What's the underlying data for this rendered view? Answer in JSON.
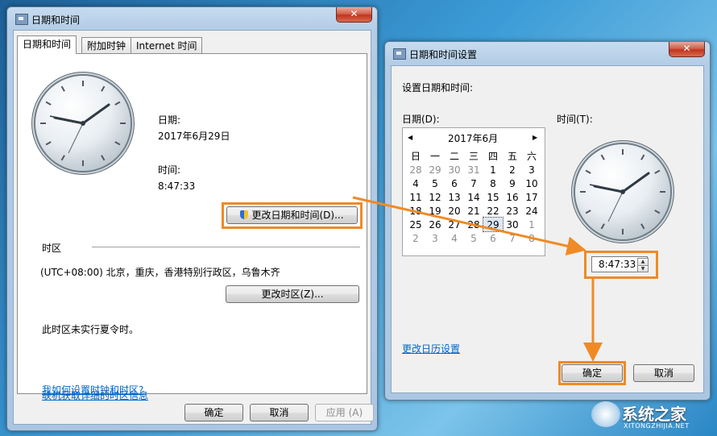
{
  "left_window": {
    "title": "日期和时间",
    "close": "✕",
    "tabs": [
      "日期和时间",
      "附加时钟",
      "Internet 时间"
    ],
    "date_label": "日期:",
    "date_value": "2017年6月29日",
    "time_label": "时间:",
    "time_value": "8:47:33",
    "change_datetime_button": "更改日期和时间(D)...",
    "timezone_heading": "时区",
    "timezone_value": "(UTC+08:00) 北京，重庆，香港特别行政区，乌鲁木齐",
    "change_timezone_button": "更改时区(Z)...",
    "dst_note": "此时区未实行夏令时。",
    "links": [
      "联机获取详细的时区信息",
      "我如何设置时钟和时区?"
    ],
    "ok": "确定",
    "cancel": "取消",
    "apply": "应用 (A)"
  },
  "right_window": {
    "title": "日期和时间设置",
    "close": "✕",
    "prompt": "设置日期和时间:",
    "date_label": "日期(D):",
    "time_label": "时间(T):",
    "month": "2017年6月",
    "prev": "◀",
    "next": "▶",
    "weekdays": [
      "日",
      "一",
      "二",
      "三",
      "四",
      "五",
      "六"
    ],
    "weeks": [
      [
        "28",
        "29",
        "30",
        "31",
        "1",
        "2",
        "3"
      ],
      [
        "4",
        "5",
        "6",
        "7",
        "8",
        "9",
        "10"
      ],
      [
        "11",
        "12",
        "13",
        "14",
        "15",
        "16",
        "17"
      ],
      [
        "18",
        "19",
        "20",
        "21",
        "22",
        "23",
        "24"
      ],
      [
        "25",
        "26",
        "27",
        "28",
        "29",
        "30",
        "1"
      ],
      [
        "2",
        "3",
        "4",
        "5",
        "6",
        "7",
        "8"
      ]
    ],
    "selected_day": "29",
    "time_value": "8:47:33",
    "calendar_link": "更改日历设置",
    "ok": "确定",
    "cancel": "取消"
  },
  "watermark": {
    "name": "系统之家",
    "url": "XITONGZHIJIA.NET"
  },
  "colors": {
    "accent_orange": "#f08a24",
    "link_blue": "#0066cc"
  }
}
